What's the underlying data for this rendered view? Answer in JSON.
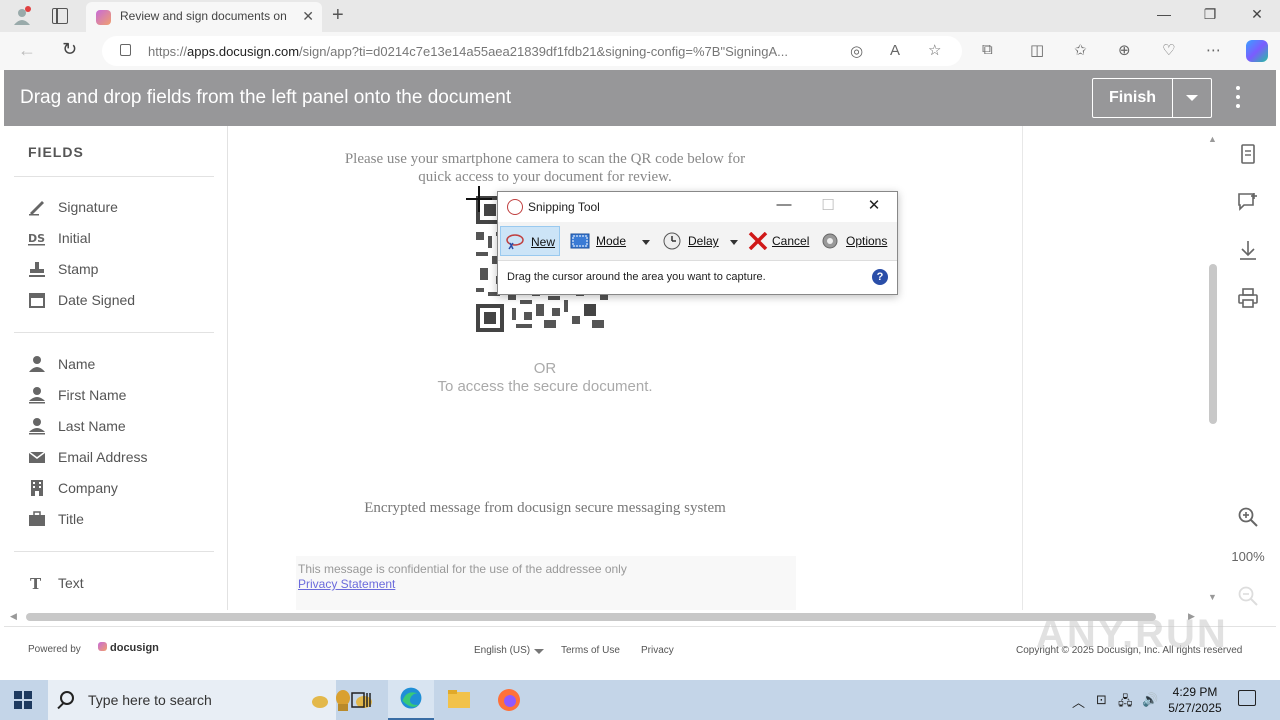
{
  "browser": {
    "tab_title": "Review and sign documents on D",
    "url_prefix": "https://",
    "url_host": "apps.docusign.com",
    "url_path": "/sign/app?ti=d0214c7e13e14a55aea21839df1fdb21&signing-config=%7B\"SigningA...",
    "new_tab_label": "+",
    "close_tab_label": "✕"
  },
  "header": {
    "headline": "Drag and drop fields from the left panel onto the document",
    "finish_label": "Finish"
  },
  "left_panel": {
    "title": "FIELDS",
    "group1": [
      {
        "label": "Signature",
        "icon": "pen-icon"
      },
      {
        "label": "Initial",
        "icon": "ds-icon"
      },
      {
        "label": "Stamp",
        "icon": "stamp-icon"
      },
      {
        "label": "Date Signed",
        "icon": "calendar-icon"
      }
    ],
    "group2": [
      {
        "label": "Name",
        "icon": "person-icon"
      },
      {
        "label": "First Name",
        "icon": "person-icon"
      },
      {
        "label": "Last Name",
        "icon": "person-icon"
      },
      {
        "label": "Email Address",
        "icon": "envelope-icon"
      },
      {
        "label": "Company",
        "icon": "building-icon"
      },
      {
        "label": "Title",
        "icon": "briefcase-icon"
      }
    ],
    "group3": [
      {
        "label": "Text",
        "icon": "text-icon"
      }
    ]
  },
  "document": {
    "scan_text": "Please use your smartphone camera to scan the QR code below for quick access to your document for review.",
    "or_text": "OR",
    "access_text": "To access the secure document.",
    "encrypted_text": "Encrypted message from docusign secure messaging system",
    "confidential_text": "This message is confidential for the use of the addressee only",
    "privacy_link": "Privacy Statement"
  },
  "right_toolbar": {
    "zoom_level": "100%"
  },
  "footer": {
    "powered_by": "Powered by",
    "brand": "docusign",
    "language": "English (US)",
    "terms": "Terms of Use",
    "privacy": "Privacy",
    "copyright": "Copyright © 2025 Docusign, Inc. All rights reserved",
    "watermark": "ANY.RUN"
  },
  "snipping_tool": {
    "title": "Snipping Tool",
    "new_label": "New",
    "mode_label": "Mode",
    "delay_label": "Delay",
    "cancel_label": "Cancel",
    "options_label": "Options",
    "status_text": "Drag the cursor around the area you want to capture.",
    "help_label": "?"
  },
  "taskbar": {
    "search_placeholder": "Type here to search",
    "time": "4:29 PM",
    "date": "5/27/2025"
  },
  "colors": {
    "header_bg": "#979799",
    "accent_blue": "#cce4f7",
    "taskbar_bg": "#c4d5e8",
    "link": "#6b6bdc"
  }
}
